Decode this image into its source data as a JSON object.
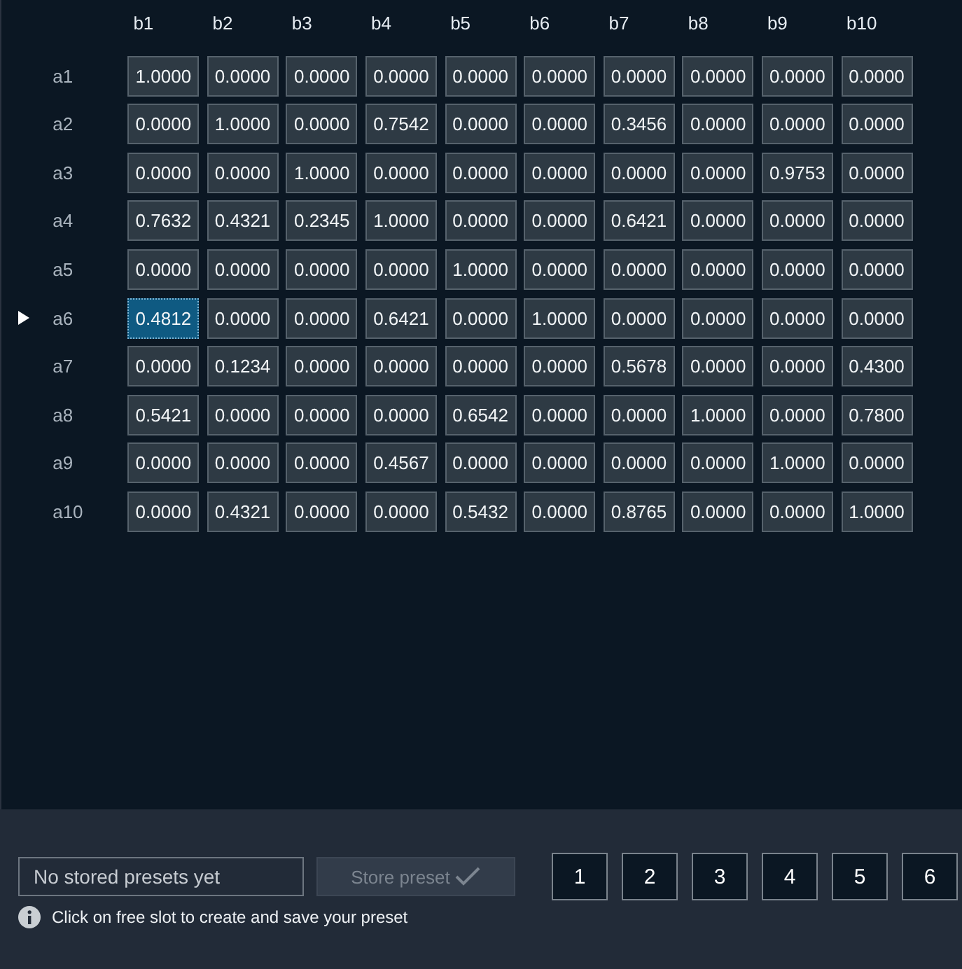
{
  "columns": [
    "b1",
    "b2",
    "b3",
    "b4",
    "b5",
    "b6",
    "b7",
    "b8",
    "b9",
    "b10"
  ],
  "rows": [
    {
      "label": "a1",
      "selected": false,
      "cells": [
        {
          "value": "1.0000",
          "selected": false
        },
        {
          "value": "0.0000",
          "selected": false
        },
        {
          "value": "0.0000",
          "selected": false
        },
        {
          "value": "0.0000",
          "selected": false
        },
        {
          "value": "0.0000",
          "selected": false
        },
        {
          "value": "0.0000",
          "selected": false
        },
        {
          "value": "0.0000",
          "selected": false
        },
        {
          "value": "0.0000",
          "selected": false
        },
        {
          "value": "0.0000",
          "selected": false
        },
        {
          "value": "0.0000",
          "selected": false
        }
      ]
    },
    {
      "label": "a2",
      "selected": false,
      "cells": [
        {
          "value": "0.0000",
          "selected": false
        },
        {
          "value": "1.0000",
          "selected": false
        },
        {
          "value": "0.0000",
          "selected": false
        },
        {
          "value": "0.7542",
          "selected": false
        },
        {
          "value": "0.0000",
          "selected": false
        },
        {
          "value": "0.0000",
          "selected": false
        },
        {
          "value": "0.3456",
          "selected": false
        },
        {
          "value": "0.0000",
          "selected": false
        },
        {
          "value": "0.0000",
          "selected": false
        },
        {
          "value": "0.0000",
          "selected": false
        }
      ]
    },
    {
      "label": "a3",
      "selected": false,
      "cells": [
        {
          "value": "0.0000",
          "selected": false
        },
        {
          "value": "0.0000",
          "selected": false
        },
        {
          "value": "1.0000",
          "selected": false
        },
        {
          "value": "0.0000",
          "selected": false
        },
        {
          "value": "0.0000",
          "selected": false
        },
        {
          "value": "0.0000",
          "selected": false
        },
        {
          "value": "0.0000",
          "selected": false
        },
        {
          "value": "0.0000",
          "selected": false
        },
        {
          "value": "0.9753",
          "selected": false
        },
        {
          "value": "0.0000",
          "selected": false
        }
      ]
    },
    {
      "label": "a4",
      "selected": false,
      "cells": [
        {
          "value": "0.7632",
          "selected": false
        },
        {
          "value": "0.4321",
          "selected": false
        },
        {
          "value": "0.2345",
          "selected": false
        },
        {
          "value": "1.0000",
          "selected": false
        },
        {
          "value": "0.0000",
          "selected": false
        },
        {
          "value": "0.0000",
          "selected": false
        },
        {
          "value": "0.6421",
          "selected": false
        },
        {
          "value": "0.0000",
          "selected": false
        },
        {
          "value": "0.0000",
          "selected": false
        },
        {
          "value": "0.0000",
          "selected": false
        }
      ]
    },
    {
      "label": "a5",
      "selected": false,
      "cells": [
        {
          "value": "0.0000",
          "selected": false
        },
        {
          "value": "0.0000",
          "selected": false
        },
        {
          "value": "0.0000",
          "selected": false
        },
        {
          "value": "0.0000",
          "selected": false
        },
        {
          "value": "1.0000",
          "selected": false
        },
        {
          "value": "0.0000",
          "selected": false
        },
        {
          "value": "0.0000",
          "selected": false
        },
        {
          "value": "0.0000",
          "selected": false
        },
        {
          "value": "0.0000",
          "selected": false
        },
        {
          "value": "0.0000",
          "selected": false
        }
      ]
    },
    {
      "label": "a6",
      "selected": true,
      "cells": [
        {
          "value": "0.4812",
          "selected": true
        },
        {
          "value": "0.0000",
          "selected": false
        },
        {
          "value": "0.0000",
          "selected": false
        },
        {
          "value": "0.6421",
          "selected": false
        },
        {
          "value": "0.0000",
          "selected": false
        },
        {
          "value": "1.0000",
          "selected": false
        },
        {
          "value": "0.0000",
          "selected": false
        },
        {
          "value": "0.0000",
          "selected": false
        },
        {
          "value": "0.0000",
          "selected": false
        },
        {
          "value": "0.0000",
          "selected": false
        }
      ]
    },
    {
      "label": "a7",
      "selected": false,
      "cells": [
        {
          "value": "0.0000",
          "selected": false
        },
        {
          "value": "0.1234",
          "selected": false
        },
        {
          "value": "0.0000",
          "selected": false
        },
        {
          "value": "0.0000",
          "selected": false
        },
        {
          "value": "0.0000",
          "selected": false
        },
        {
          "value": "0.0000",
          "selected": false
        },
        {
          "value": "0.5678",
          "selected": false
        },
        {
          "value": "0.0000",
          "selected": false
        },
        {
          "value": "0.0000",
          "selected": false
        },
        {
          "value": "0.4300",
          "selected": false
        }
      ]
    },
    {
      "label": "a8",
      "selected": false,
      "cells": [
        {
          "value": "0.5421",
          "selected": false
        },
        {
          "value": "0.0000",
          "selected": false
        },
        {
          "value": "0.0000",
          "selected": false
        },
        {
          "value": "0.0000",
          "selected": false
        },
        {
          "value": "0.6542",
          "selected": false
        },
        {
          "value": "0.0000",
          "selected": false
        },
        {
          "value": "0.0000",
          "selected": false
        },
        {
          "value": "1.0000",
          "selected": false
        },
        {
          "value": "0.0000",
          "selected": false
        },
        {
          "value": "0.7800",
          "selected": false
        }
      ]
    },
    {
      "label": "a9",
      "selected": false,
      "cells": [
        {
          "value": "0.0000",
          "selected": false
        },
        {
          "value": "0.0000",
          "selected": false
        },
        {
          "value": "0.0000",
          "selected": false
        },
        {
          "value": "0.4567",
          "selected": false
        },
        {
          "value": "0.0000",
          "selected": false
        },
        {
          "value": "0.0000",
          "selected": false
        },
        {
          "value": "0.0000",
          "selected": false
        },
        {
          "value": "0.0000",
          "selected": false
        },
        {
          "value": "1.0000",
          "selected": false
        },
        {
          "value": "0.0000",
          "selected": false
        }
      ]
    },
    {
      "label": "a10",
      "selected": false,
      "cells": [
        {
          "value": "0.0000",
          "selected": false
        },
        {
          "value": "0.4321",
          "selected": false
        },
        {
          "value": "0.0000",
          "selected": false
        },
        {
          "value": "0.0000",
          "selected": false
        },
        {
          "value": "0.5432",
          "selected": false
        },
        {
          "value": "0.0000",
          "selected": false
        },
        {
          "value": "0.8765",
          "selected": false
        },
        {
          "value": "0.0000",
          "selected": false
        },
        {
          "value": "0.0000",
          "selected": false
        },
        {
          "value": "1.0000",
          "selected": false
        }
      ]
    }
  ],
  "presets": {
    "name_field": {
      "placeholder": "No stored presets yet"
    },
    "store_button": {
      "label": "Store preset",
      "disabled": true
    },
    "slots": [
      "1",
      "2",
      "3",
      "4",
      "5",
      "6"
    ],
    "hint": "Click on free slot to create and save your preset"
  }
}
